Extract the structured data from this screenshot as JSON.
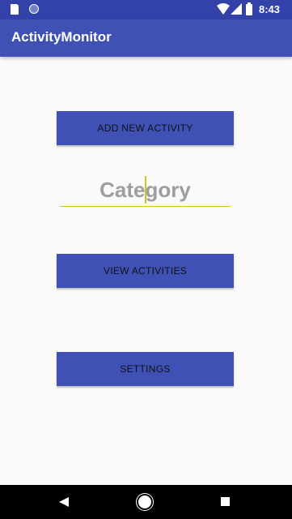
{
  "status_bar": {
    "time": "8:43",
    "icons": [
      "sd-card-icon",
      "circle-icon",
      "wifi-icon",
      "signal-icon",
      "battery-icon"
    ]
  },
  "app_bar": {
    "title": "ActivityMonitor"
  },
  "main": {
    "add_button_label": "ADD NEW ACTIVITY",
    "category_placeholder": "Category",
    "view_button_label": "VIEW ACTIVITIES",
    "settings_button_label": "SETTINGS"
  },
  "nav_bar": {
    "icons": [
      "back-icon",
      "home-icon",
      "recents-icon"
    ]
  },
  "colors": {
    "primary": "#3f51b5",
    "primary_dark": "#3242a8",
    "accent_underline": "#d4c21e",
    "background": "#fafafa"
  }
}
